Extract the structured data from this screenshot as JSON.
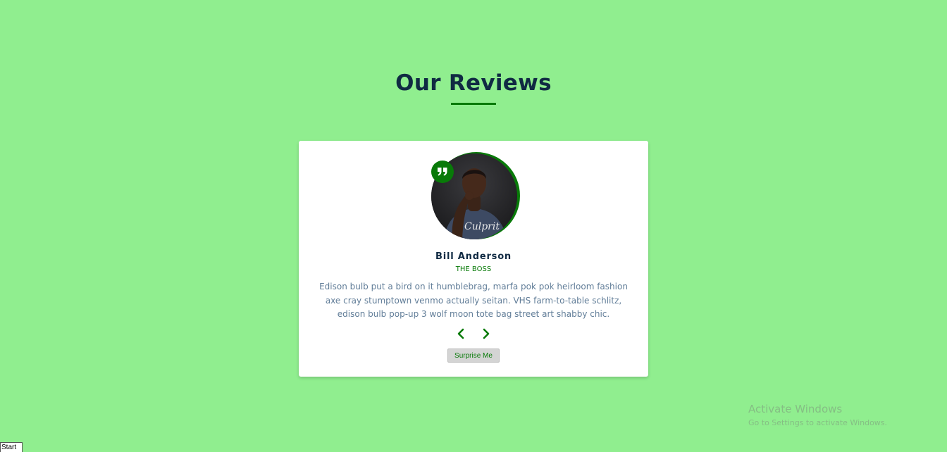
{
  "page": {
    "title": "Our Reviews",
    "accent_color": "#087a08",
    "background_color": "#90ee8f"
  },
  "review": {
    "name": "Bill Anderson",
    "job": "THE BOSS",
    "text": "Edison bulb put a bird on it humblebrag, marfa pok pok heirloom fashion axe cray stumptown venmo actually seitan. VHS farm-to-table schlitz, edison bulb pop-up 3 wolf moon tote bag street art shabby chic.",
    "avatar_shirt_text": "Culprit",
    "quote_icon": "quote-right-icon"
  },
  "controls": {
    "prev_icon": "chevron-left-icon",
    "next_icon": "chevron-right-icon",
    "random_label": "Surprise Me"
  },
  "watermark": {
    "title": "Activate Windows",
    "subtitle": "Go to Settings to activate Windows."
  },
  "taskbar": {
    "start_label": "Start"
  }
}
